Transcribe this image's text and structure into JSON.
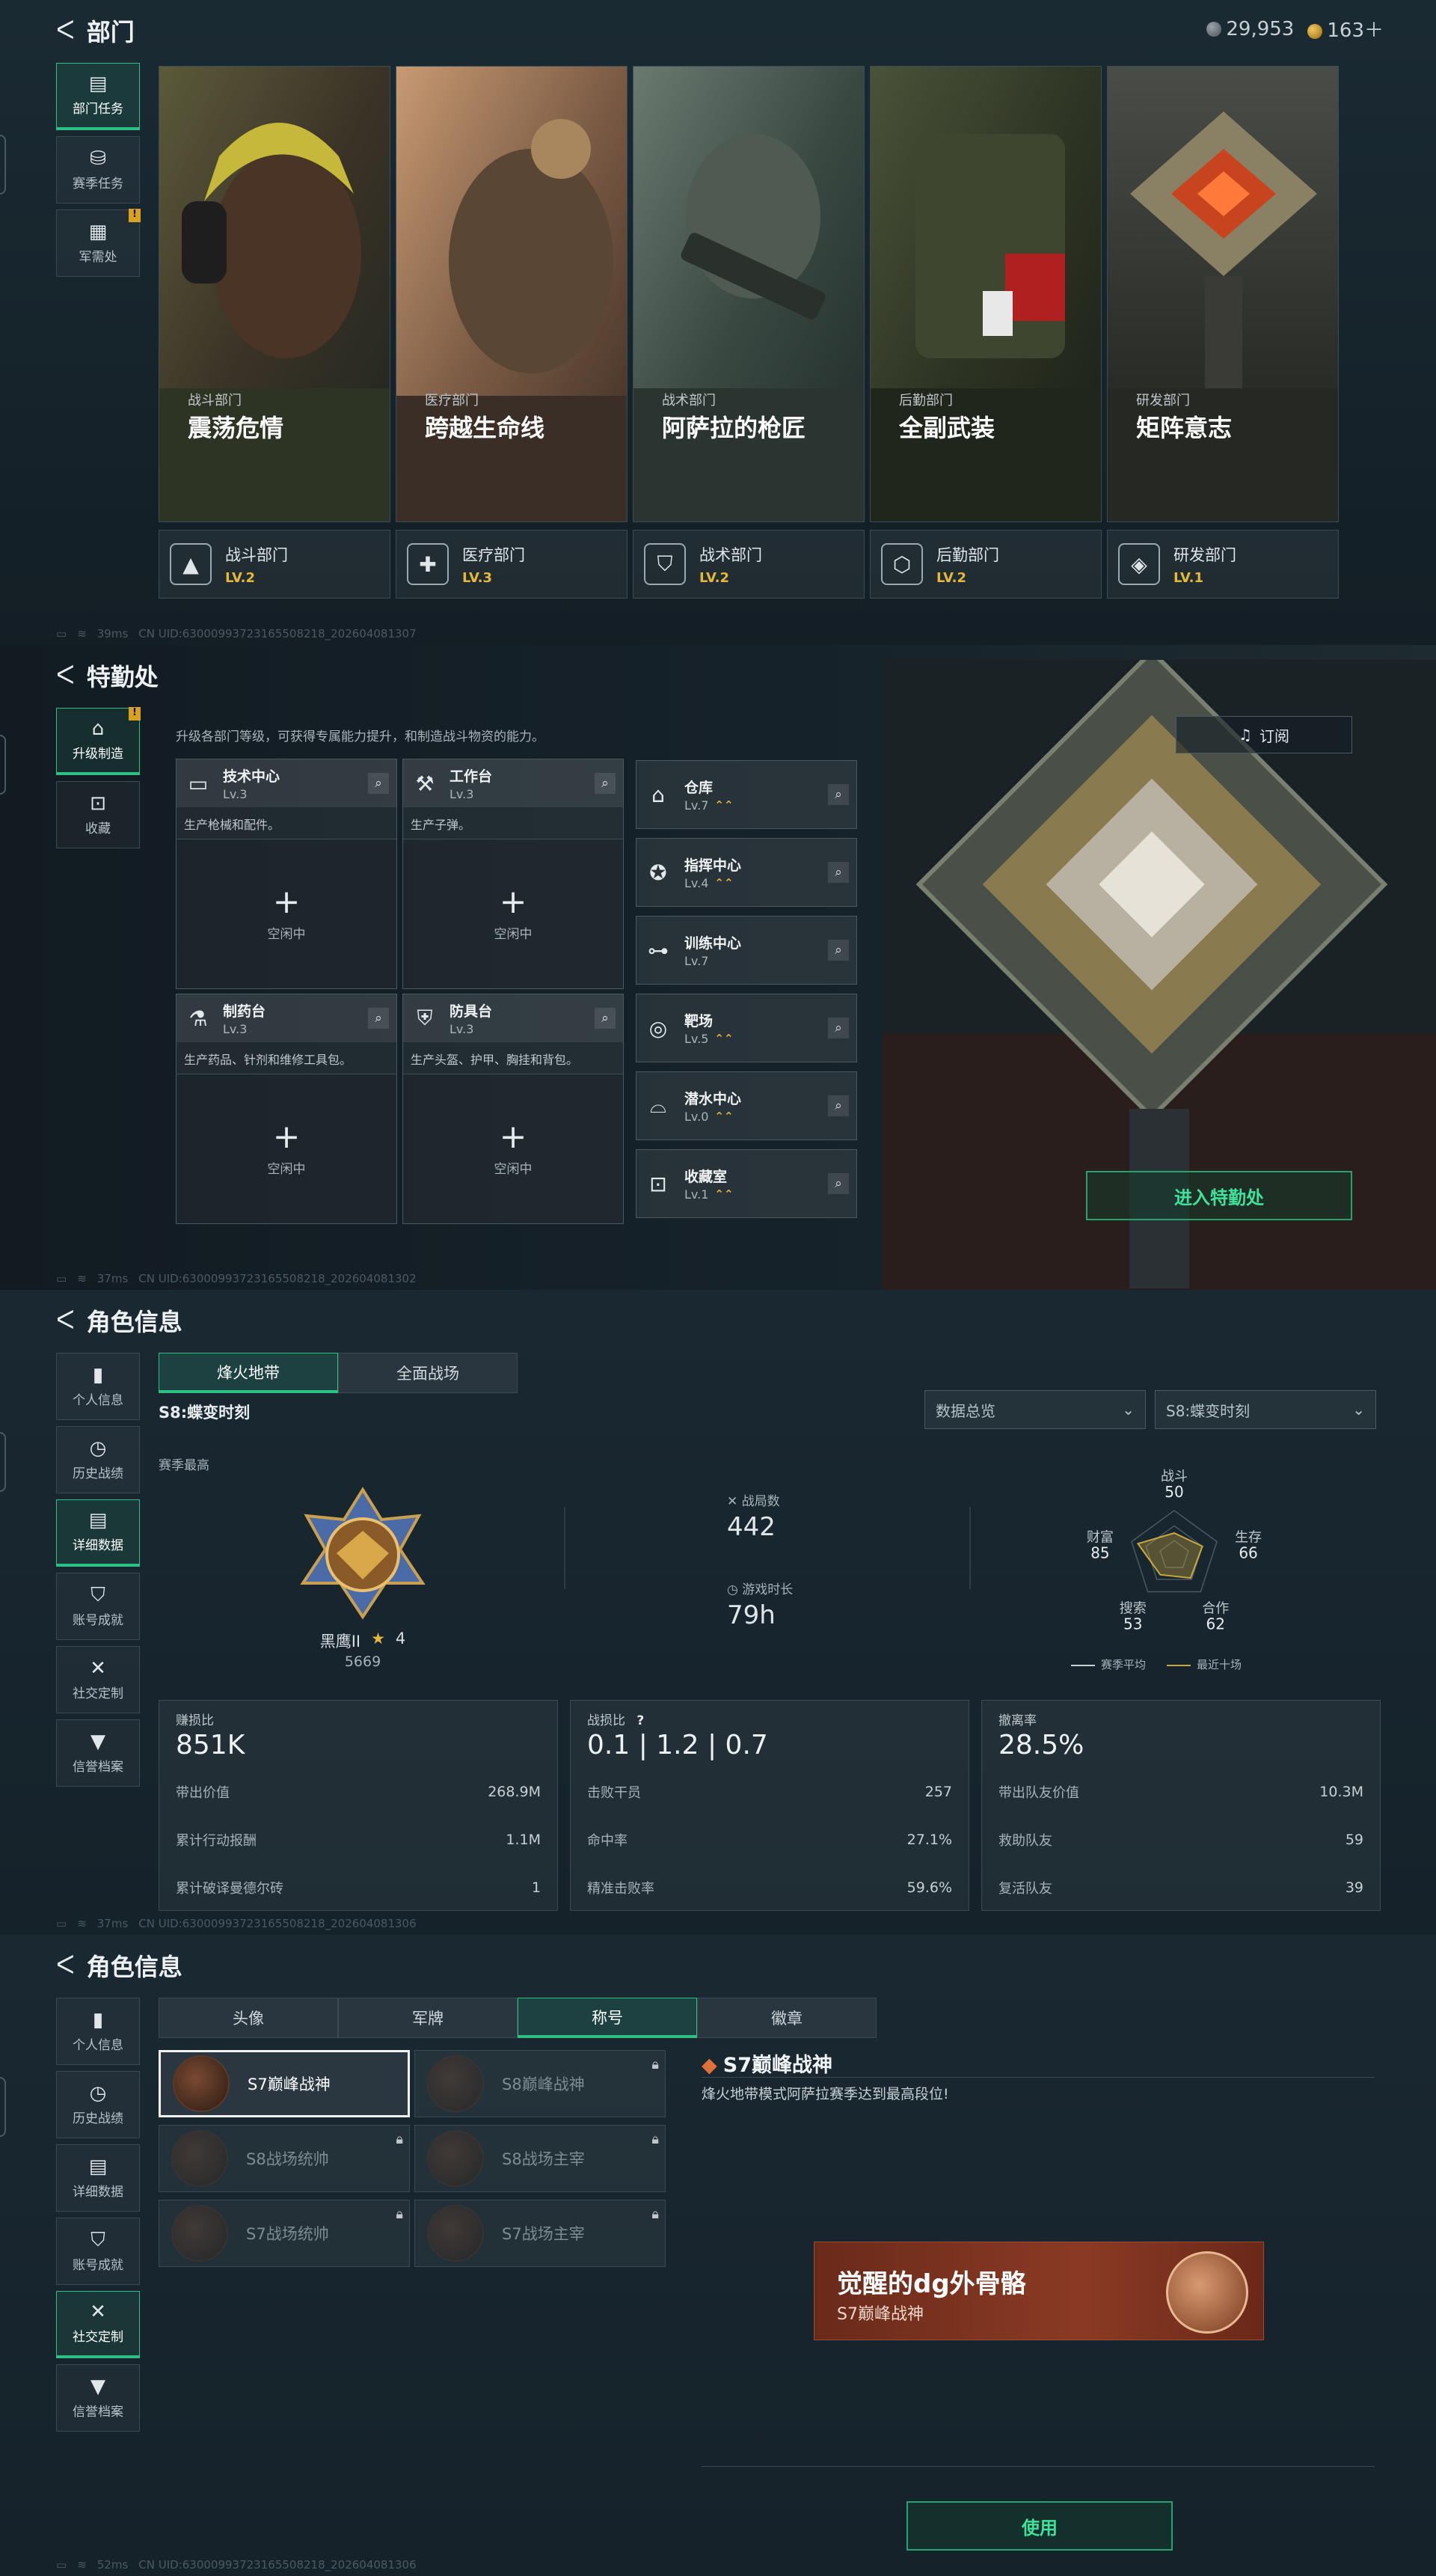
{
  "s1": {
    "title": "部门",
    "currency1": "29,953",
    "currency2": "163＋",
    "side": [
      "部门任务",
      "赛季任务",
      "军需处"
    ],
    "cards": [
      {
        "sub": "战斗部门",
        "name": "震荡危情",
        "bar": "战斗部门",
        "lv": "LV.2"
      },
      {
        "sub": "医疗部门",
        "name": "跨越生命线",
        "bar": "医疗部门",
        "lv": "LV.3"
      },
      {
        "sub": "战术部门",
        "name": "阿萨拉的枪匠",
        "bar": "战术部门",
        "lv": "LV.2"
      },
      {
        "sub": "后勤部门",
        "name": "全副武装",
        "bar": "后勤部门",
        "lv": "LV.2"
      },
      {
        "sub": "研发部门",
        "name": "矩阵意志",
        "bar": "研发部门",
        "lv": "LV.1"
      }
    ],
    "ping": "39ms",
    "uid": "CN UID:63000993723165508218_202604081307"
  },
  "s2": {
    "title": "特勤处",
    "side": [
      "升级制造",
      "收藏"
    ],
    "desc": "升级各部门等级，可获得专属能力提升，和制造战斗物资的能力。",
    "facilities": [
      {
        "name": "技术中心",
        "lv": "Lv.3",
        "desc": "生产枪械和配件。",
        "idle": "空闲中"
      },
      {
        "name": "工作台",
        "lv": "Lv.3",
        "desc": "生产子弹。",
        "idle": "空闲中"
      },
      {
        "name": "制药台",
        "lv": "Lv.3",
        "desc": "生产药品、针剂和维修工具包。",
        "idle": "空闲中"
      },
      {
        "name": "防具台",
        "lv": "Lv.3",
        "desc": "生产头盔、护甲、胸挂和背包。",
        "idle": "空闲中"
      }
    ],
    "rooms": [
      {
        "name": "仓库",
        "lv": "Lv.7",
        "up": "⌃⌃"
      },
      {
        "name": "指挥中心",
        "lv": "Lv.4",
        "up": "⌃⌃"
      },
      {
        "name": "训练中心",
        "lv": "Lv.7",
        "up": ""
      },
      {
        "name": "靶场",
        "lv": "Lv.5",
        "up": "⌃⌃"
      },
      {
        "name": "潜水中心",
        "lv": "Lv.0",
        "up": "⌃⌃"
      },
      {
        "name": "收藏室",
        "lv": "Lv.1",
        "up": "⌃⌃"
      }
    ],
    "subscribe": "订阅",
    "enter": "进入特勤处",
    "ping": "37ms",
    "uid": "CN UID:63000993723165508218_202604081302"
  },
  "s3": {
    "title": "角色信息",
    "side": [
      "个人信息",
      "历史战绩",
      "详细数据",
      "账号成就",
      "社交定制",
      "信誉档案"
    ],
    "tabs": [
      "烽火地带",
      "全面战场"
    ],
    "season": "S8:蝶变时刻",
    "dd1": "数据总览",
    "dd2": "S8:蝶变时刻",
    "season_best": "赛季最高",
    "rank": "黑鹰II",
    "stars": "4",
    "score": "5669",
    "battles_label": "战局数",
    "battles": "442",
    "time_label": "游戏时长",
    "time": "79h",
    "radar": {
      "labels": [
        "战斗",
        "生存",
        "合作",
        "搜索",
        "财富"
      ],
      "values": [
        "50",
        "66",
        "62",
        "53",
        "85"
      ],
      "legend1": "赛季平均",
      "legend2": "最近十场"
    },
    "cards": [
      {
        "title": "赚损比",
        "big": "851K",
        "rows": [
          [
            "带出价值",
            "268.9M"
          ],
          [
            "累计行动报酬",
            "1.1M"
          ],
          [
            "累计破译曼德尔砖",
            "1"
          ]
        ]
      },
      {
        "title": "战损比",
        "big": "0.1 | 1.2 | 0.7",
        "help": "?",
        "rows": [
          [
            "击败干员",
            "257"
          ],
          [
            "命中率",
            "27.1%"
          ],
          [
            "精准击败率",
            "59.6%"
          ]
        ]
      },
      {
        "title": "撤离率",
        "big": "28.5%",
        "rows": [
          [
            "带出队友价值",
            "10.3M"
          ],
          [
            "救助队友",
            "59"
          ],
          [
            "复活队友",
            "39"
          ]
        ]
      }
    ],
    "ping": "37ms",
    "uid": "CN UID:63000993723165508218_202604081306"
  },
  "s4": {
    "title": "角色信息",
    "side": [
      "个人信息",
      "历史战绩",
      "详细数据",
      "账号成就",
      "社交定制",
      "信誉档案"
    ],
    "tabs": [
      "头像",
      "军牌",
      "称号",
      "徽章"
    ],
    "titles": [
      "S7巅峰战神",
      "S8巅峰战神",
      "S8战场统帅",
      "S8战场主宰",
      "S7战场统帅",
      "S7战场主宰"
    ],
    "detail_name": "S7巅峰战神",
    "detail_desc": "烽火地带模式阿萨拉赛季达到最高段位!",
    "banner_title": "觉醒的dg外骨骼",
    "banner_sub": "S7巅峰战神",
    "use": "使用",
    "ping": "52ms",
    "uid": "CN UID:63000993723165508218_202604081306"
  }
}
